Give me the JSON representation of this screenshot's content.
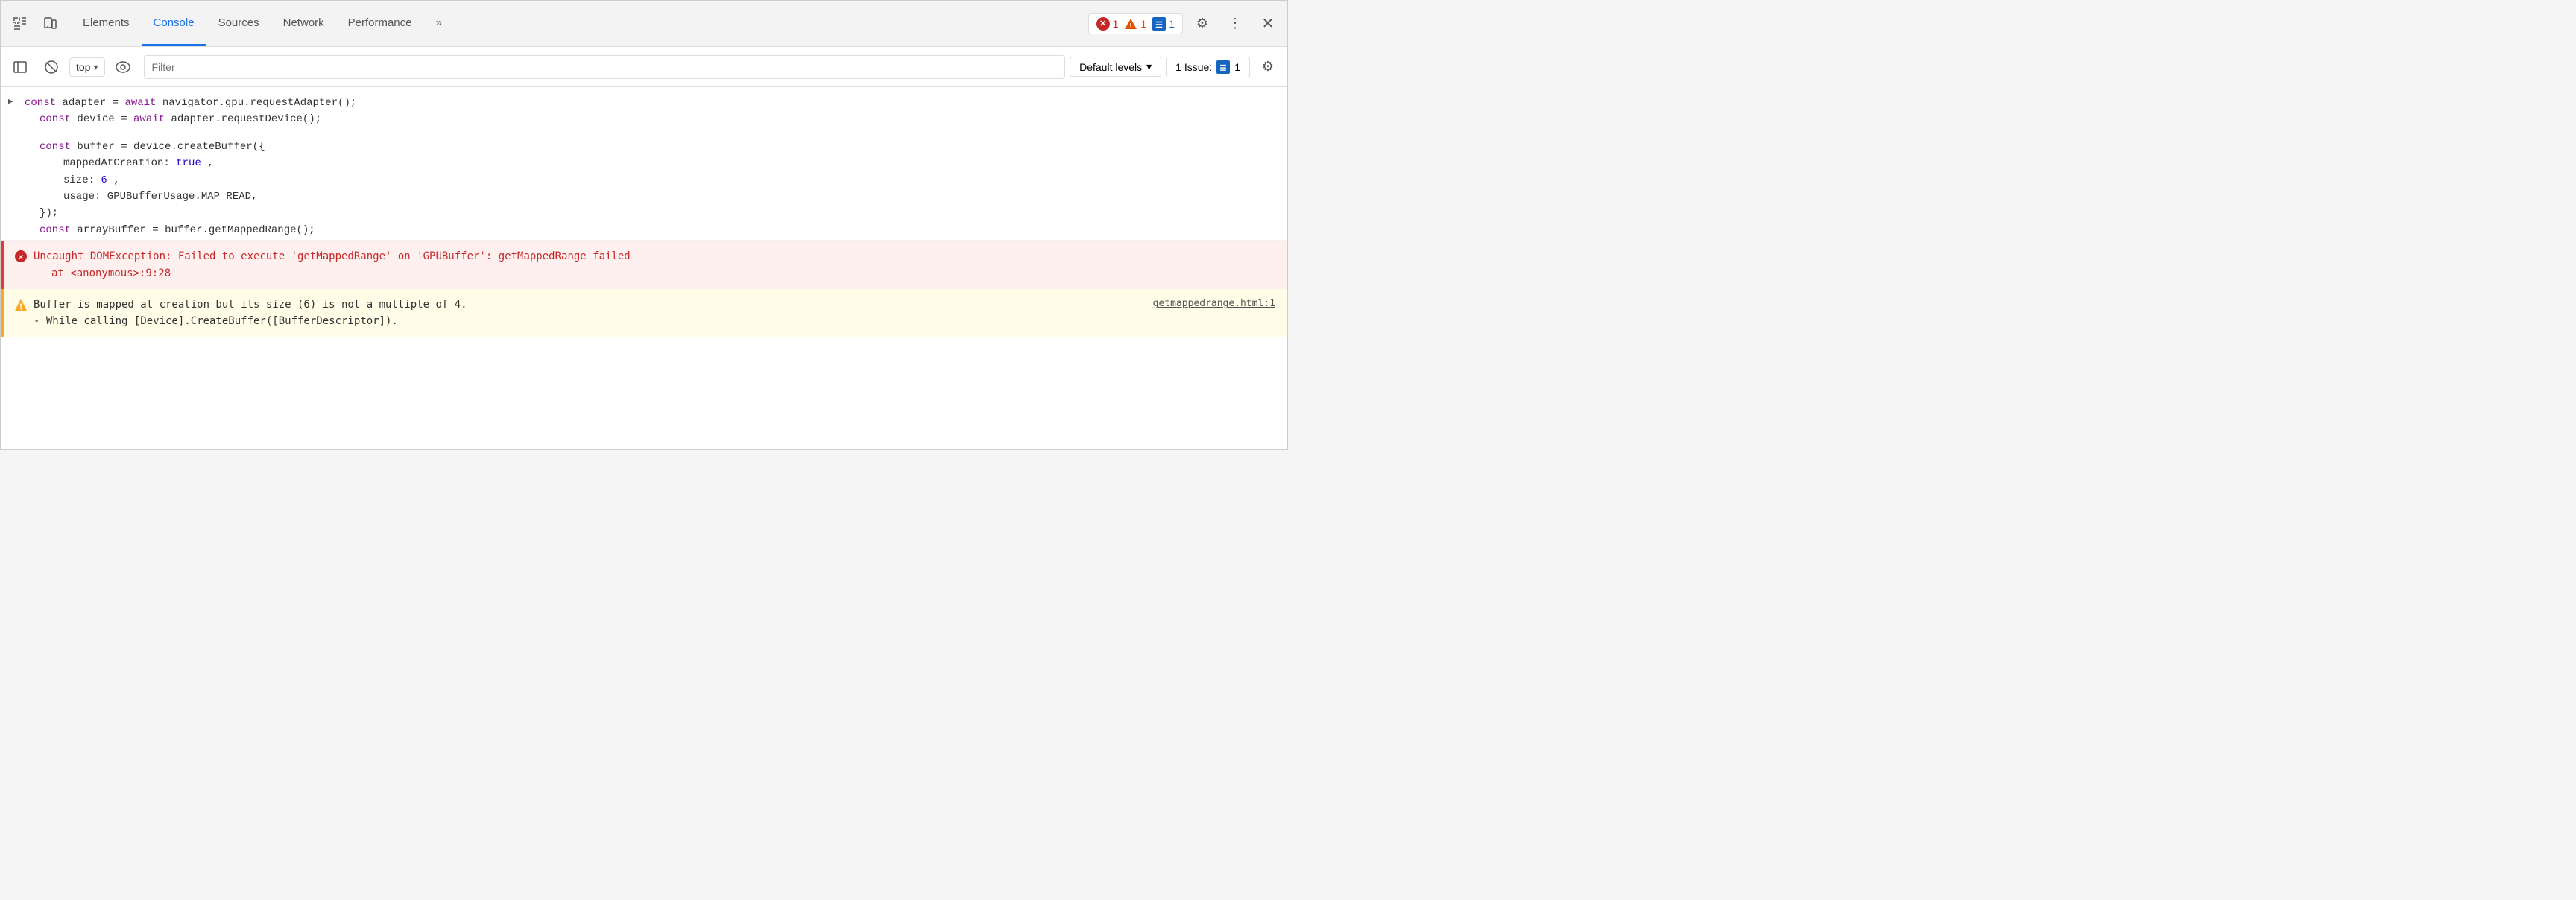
{
  "toolbar": {
    "tabs": [
      {
        "id": "elements",
        "label": "Elements",
        "active": false
      },
      {
        "id": "console",
        "label": "Console",
        "active": true
      },
      {
        "id": "sources",
        "label": "Sources",
        "active": false
      },
      {
        "id": "network",
        "label": "Network",
        "active": false
      },
      {
        "id": "performance",
        "label": "Performance",
        "active": false
      },
      {
        "id": "more",
        "label": "»",
        "active": false
      }
    ],
    "error_count": "1",
    "warning_count": "1",
    "info_count": "1",
    "more_icon": "⋮",
    "close_icon": "✕"
  },
  "console_toolbar": {
    "top_label": "top",
    "filter_placeholder": "Filter",
    "levels_label": "Default levels",
    "issues_label": "1 Issue:",
    "issues_count": "1"
  },
  "console": {
    "lines": [
      {
        "type": "code",
        "has_arrow": true,
        "content": "const adapter = await navigator.gpu.requestAdapter();"
      },
      {
        "type": "code",
        "indent": 1,
        "content": "const device = await adapter.requestDevice();"
      },
      {
        "type": "code",
        "indent": 1,
        "content": "const buffer = device.createBuffer({"
      },
      {
        "type": "code",
        "indent": 2,
        "content": "mappedAtCreation: true,"
      },
      {
        "type": "code",
        "indent": 2,
        "content": "size: 6,"
      },
      {
        "type": "code",
        "indent": 2,
        "content": "usage: GPUBufferUsage.MAP_READ,"
      },
      {
        "type": "code",
        "indent": 1,
        "content": "});"
      },
      {
        "type": "code",
        "indent": 1,
        "content": "const arrayBuffer = buffer.getMappedRange();"
      }
    ],
    "error": {
      "main": "Uncaught DOMException: Failed to execute 'getMappedRange' on 'GPUBuffer': getMappedRange failed",
      "sub": "at <anonymous>:9:28"
    },
    "warning": {
      "main": "Buffer is mapped at creation but its size (6) is not a multiple of 4.",
      "sub": "- While calling [Device].CreateBuffer([BufferDescriptor]).",
      "link": "getmappedrange.html:1"
    }
  },
  "icons": {
    "inspect": "⬚",
    "device": "📱",
    "sidebar": "▶",
    "ban": "⊘",
    "eye": "👁",
    "gear": "⚙",
    "chevron_down": "▾",
    "error": "✕",
    "warning": "!"
  }
}
